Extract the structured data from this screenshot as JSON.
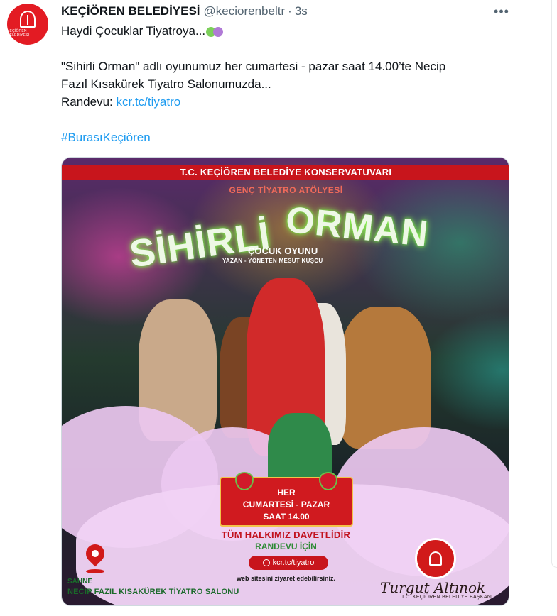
{
  "tweet": {
    "author_name": "KEÇİÖREN BELEDİYESİ",
    "handle": "@keciorenbeltr",
    "separator": "·",
    "time": "3s",
    "more_icon": "more-horizontal-icon",
    "more_label": "•••",
    "avatar_text": "KEÇİÖREN BELEDİYESİ",
    "line1": "Haydi Çocuklar Tiyatroya...",
    "line2": "\"Sihirli Orman\" adlı oyunumuz her cumartesi - pazar saat 14.00’te Necip",
    "line3": "Fazıl Kısakürek Tiyatro Salonumuzda...",
    "randevu_label": "Randevu: ",
    "link": "kcr.tc/tiyatro",
    "hashtag": "#BurasıKeçiören"
  },
  "poster": {
    "top_ribbon": "T.C. KEÇİÖREN BELEDİYE KONSERVATUVARI",
    "workshop": "GENÇ TİYATRO ATÖLYESİ",
    "title_word1": "SİHİRLİ",
    "title_word2": "ORMAN",
    "subtitle": "ÇOCUK OYUNU",
    "author_line": "YAZAN - YÖNETEN MESUT KUŞCU",
    "banner_line1": "HER",
    "banner_line2": "CUMARTESİ - PAZAR",
    "banner_line3": "SAAT 14.00",
    "invite": "TÜM HALKIMIZ DAVETLİDİR",
    "randevu": "RANDEVU İÇİN",
    "url": "kcr.tc/tiyatro",
    "visit": "web sitesini ziyaret edebilirsiniz.",
    "venue_label": "SAHNE",
    "venue": "NECİP FAZIL KISAKÜREK TİYATRO SALONU",
    "signature": "Turgut Altınok",
    "mayor_title": "T.C. KEÇİÖREN BELEDİYE BAŞKANI"
  },
  "colors": {
    "link": "#1d9bf0",
    "brand_red": "#c8151c",
    "neon_green": "#9bff5a"
  }
}
